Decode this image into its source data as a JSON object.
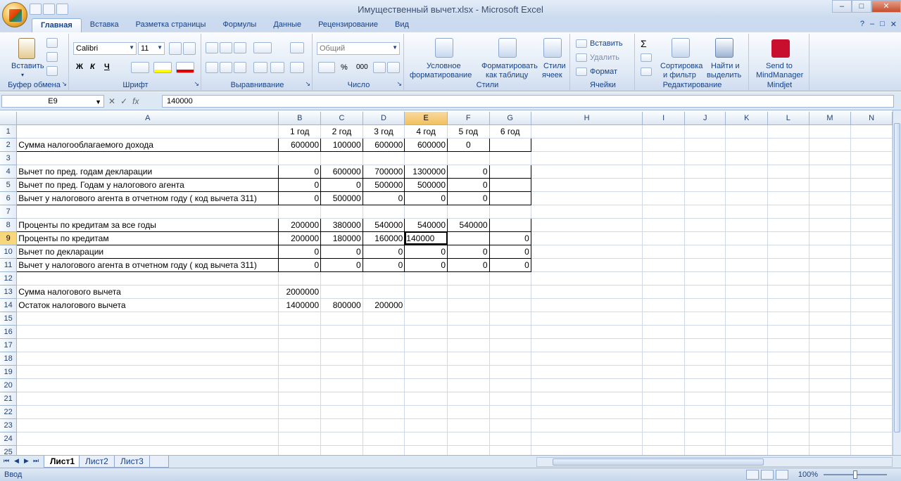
{
  "window": {
    "title": "Имущественный вычет.xlsx - Microsoft Excel"
  },
  "tabs": [
    "Главная",
    "Вставка",
    "Разметка страницы",
    "Формулы",
    "Данные",
    "Рецензирование",
    "Вид"
  ],
  "ribbon": {
    "clipboard": {
      "label": "Буфер обмена",
      "paste": "Вставить"
    },
    "font": {
      "label": "Шрифт",
      "name": "Calibri",
      "size": "11",
      "bold": "Ж",
      "italic": "К",
      "underline": "Ч"
    },
    "alignment": {
      "label": "Выравнивание"
    },
    "number": {
      "label": "Число",
      "format": "Общий"
    },
    "styles": {
      "label": "Стили",
      "conditional": "Условное",
      "conditional2": "форматирование",
      "table": "Форматировать",
      "table2": "как таблицу",
      "cell_styles": "Стили",
      "cell_styles2": "ячеек"
    },
    "cells": {
      "label": "Ячейки",
      "insert": "Вставить",
      "delete": "Удалить",
      "format": "Формат"
    },
    "editing": {
      "label": "Редактирование",
      "sort": "Сортировка",
      "sort2": "и фильтр",
      "find": "Найти и",
      "find2": "выделить"
    },
    "mindjet": {
      "label": "Mindjet",
      "send": "Send to",
      "send2": "MindManager"
    }
  },
  "formula_bar": {
    "name_box": "E9",
    "value": "140000"
  },
  "columns": [
    "A",
    "B",
    "C",
    "D",
    "E",
    "F",
    "G",
    "H",
    "I",
    "J",
    "K",
    "L",
    "M",
    "N"
  ],
  "rows": [
    {
      "n": "1",
      "a": "",
      "b": "1 год",
      "c": "2 год",
      "d": "3 год",
      "e": "4 год",
      "f": "5 год",
      "g": "6 год"
    },
    {
      "n": "2",
      "a": "Сумма налогооблагаемого дохода",
      "b": "600000",
      "c": "100000",
      "d": "600000",
      "e": "600000",
      "f": "0",
      "g": ""
    },
    {
      "n": "3",
      "a": "",
      "b": "",
      "c": "",
      "d": "",
      "e": "",
      "f": "",
      "g": ""
    },
    {
      "n": "4",
      "a": "Вычет по пред.  годам декларации",
      "b": "0",
      "c": "600000",
      "d": "700000",
      "e": "1300000",
      "f": "0",
      "g": ""
    },
    {
      "n": "5",
      "a": "Вычет по пред. Годам у налогового агента",
      "b": "0",
      "c": "0",
      "d": "500000",
      "e": "500000",
      "f": "0",
      "g": ""
    },
    {
      "n": "6",
      "a": "Вычет у налогового агента в отчетном году ( код вычета 311)",
      "b": "0",
      "c": "500000",
      "d": "0",
      "e": "0",
      "f": "0",
      "g": ""
    },
    {
      "n": "7",
      "a": "",
      "b": "",
      "c": "",
      "d": "",
      "e": "",
      "f": "",
      "g": ""
    },
    {
      "n": "8",
      "a": "Проценты по кредитам за все годы",
      "b": "200000",
      "c": "380000",
      "d": "540000",
      "e": "540000",
      "f": "540000",
      "g": ""
    },
    {
      "n": "9",
      "a": "Проценты по кредитам",
      "b": "200000",
      "c": "180000",
      "d": "160000",
      "e": "140000",
      "f": "",
      "g": "0"
    },
    {
      "n": "10",
      "a": "Вычет по декларации",
      "b": "0",
      "c": "0",
      "d": "0",
      "e": "0",
      "f": "0",
      "g": "0"
    },
    {
      "n": "11",
      "a": "Вычет у налогового агента в отчетном году ( код вычета 311)",
      "b": "0",
      "c": "0",
      "d": "0",
      "e": "0",
      "f": "0",
      "g": "0"
    },
    {
      "n": "12",
      "a": "",
      "b": "",
      "c": "",
      "d": "",
      "e": "",
      "f": "",
      "g": ""
    },
    {
      "n": "13",
      "a": "Сумма налогового вычета",
      "b": "2000000",
      "c": "",
      "d": "",
      "e": "",
      "f": "",
      "g": ""
    },
    {
      "n": "14",
      "a": "Остаток налогового вычета",
      "b": "1400000",
      "c": "800000",
      "d": "200000",
      "e": "",
      "f": "",
      "g": ""
    },
    {
      "n": "15"
    },
    {
      "n": "16"
    },
    {
      "n": "17"
    },
    {
      "n": "18"
    },
    {
      "n": "19"
    },
    {
      "n": "20"
    },
    {
      "n": "21"
    },
    {
      "n": "22"
    },
    {
      "n": "23"
    },
    {
      "n": "24"
    },
    {
      "n": "25"
    }
  ],
  "sheets": [
    "Лист1",
    "Лист2",
    "Лист3"
  ],
  "status": {
    "mode": "Ввод",
    "zoom": "100%"
  }
}
